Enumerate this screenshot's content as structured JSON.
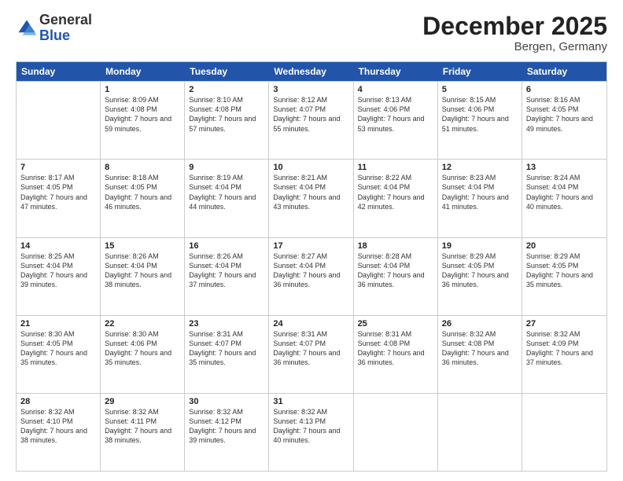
{
  "header": {
    "logo_general": "General",
    "logo_blue": "Blue",
    "month_title": "December 2025",
    "location": "Bergen, Germany"
  },
  "days_of_week": [
    "Sunday",
    "Monday",
    "Tuesday",
    "Wednesday",
    "Thursday",
    "Friday",
    "Saturday"
  ],
  "weeks": [
    [
      {
        "day": "",
        "sunrise": "",
        "sunset": "",
        "daylight": ""
      },
      {
        "day": "1",
        "sunrise": "Sunrise: 8:09 AM",
        "sunset": "Sunset: 4:08 PM",
        "daylight": "Daylight: 7 hours and 59 minutes."
      },
      {
        "day": "2",
        "sunrise": "Sunrise: 8:10 AM",
        "sunset": "Sunset: 4:08 PM",
        "daylight": "Daylight: 7 hours and 57 minutes."
      },
      {
        "day": "3",
        "sunrise": "Sunrise: 8:12 AM",
        "sunset": "Sunset: 4:07 PM",
        "daylight": "Daylight: 7 hours and 55 minutes."
      },
      {
        "day": "4",
        "sunrise": "Sunrise: 8:13 AM",
        "sunset": "Sunset: 4:06 PM",
        "daylight": "Daylight: 7 hours and 53 minutes."
      },
      {
        "day": "5",
        "sunrise": "Sunrise: 8:15 AM",
        "sunset": "Sunset: 4:06 PM",
        "daylight": "Daylight: 7 hours and 51 minutes."
      },
      {
        "day": "6",
        "sunrise": "Sunrise: 8:16 AM",
        "sunset": "Sunset: 4:05 PM",
        "daylight": "Daylight: 7 hours and 49 minutes."
      }
    ],
    [
      {
        "day": "7",
        "sunrise": "Sunrise: 8:17 AM",
        "sunset": "Sunset: 4:05 PM",
        "daylight": "Daylight: 7 hours and 47 minutes."
      },
      {
        "day": "8",
        "sunrise": "Sunrise: 8:18 AM",
        "sunset": "Sunset: 4:05 PM",
        "daylight": "Daylight: 7 hours and 46 minutes."
      },
      {
        "day": "9",
        "sunrise": "Sunrise: 8:19 AM",
        "sunset": "Sunset: 4:04 PM",
        "daylight": "Daylight: 7 hours and 44 minutes."
      },
      {
        "day": "10",
        "sunrise": "Sunrise: 8:21 AM",
        "sunset": "Sunset: 4:04 PM",
        "daylight": "Daylight: 7 hours and 43 minutes."
      },
      {
        "day": "11",
        "sunrise": "Sunrise: 8:22 AM",
        "sunset": "Sunset: 4:04 PM",
        "daylight": "Daylight: 7 hours and 42 minutes."
      },
      {
        "day": "12",
        "sunrise": "Sunrise: 8:23 AM",
        "sunset": "Sunset: 4:04 PM",
        "daylight": "Daylight: 7 hours and 41 minutes."
      },
      {
        "day": "13",
        "sunrise": "Sunrise: 8:24 AM",
        "sunset": "Sunset: 4:04 PM",
        "daylight": "Daylight: 7 hours and 40 minutes."
      }
    ],
    [
      {
        "day": "14",
        "sunrise": "Sunrise: 8:25 AM",
        "sunset": "Sunset: 4:04 PM",
        "daylight": "Daylight: 7 hours and 39 minutes."
      },
      {
        "day": "15",
        "sunrise": "Sunrise: 8:26 AM",
        "sunset": "Sunset: 4:04 PM",
        "daylight": "Daylight: 7 hours and 38 minutes."
      },
      {
        "day": "16",
        "sunrise": "Sunrise: 8:26 AM",
        "sunset": "Sunset: 4:04 PM",
        "daylight": "Daylight: 7 hours and 37 minutes."
      },
      {
        "day": "17",
        "sunrise": "Sunrise: 8:27 AM",
        "sunset": "Sunset: 4:04 PM",
        "daylight": "Daylight: 7 hours and 36 minutes."
      },
      {
        "day": "18",
        "sunrise": "Sunrise: 8:28 AM",
        "sunset": "Sunset: 4:04 PM",
        "daylight": "Daylight: 7 hours and 36 minutes."
      },
      {
        "day": "19",
        "sunrise": "Sunrise: 8:29 AM",
        "sunset": "Sunset: 4:05 PM",
        "daylight": "Daylight: 7 hours and 36 minutes."
      },
      {
        "day": "20",
        "sunrise": "Sunrise: 8:29 AM",
        "sunset": "Sunset: 4:05 PM",
        "daylight": "Daylight: 7 hours and 35 minutes."
      }
    ],
    [
      {
        "day": "21",
        "sunrise": "Sunrise: 8:30 AM",
        "sunset": "Sunset: 4:05 PM",
        "daylight": "Daylight: 7 hours and 35 minutes."
      },
      {
        "day": "22",
        "sunrise": "Sunrise: 8:30 AM",
        "sunset": "Sunset: 4:06 PM",
        "daylight": "Daylight: 7 hours and 35 minutes."
      },
      {
        "day": "23",
        "sunrise": "Sunrise: 8:31 AM",
        "sunset": "Sunset: 4:07 PM",
        "daylight": "Daylight: 7 hours and 35 minutes."
      },
      {
        "day": "24",
        "sunrise": "Sunrise: 8:31 AM",
        "sunset": "Sunset: 4:07 PM",
        "daylight": "Daylight: 7 hours and 36 minutes."
      },
      {
        "day": "25",
        "sunrise": "Sunrise: 8:31 AM",
        "sunset": "Sunset: 4:08 PM",
        "daylight": "Daylight: 7 hours and 36 minutes."
      },
      {
        "day": "26",
        "sunrise": "Sunrise: 8:32 AM",
        "sunset": "Sunset: 4:08 PM",
        "daylight": "Daylight: 7 hours and 36 minutes."
      },
      {
        "day": "27",
        "sunrise": "Sunrise: 8:32 AM",
        "sunset": "Sunset: 4:09 PM",
        "daylight": "Daylight: 7 hours and 37 minutes."
      }
    ],
    [
      {
        "day": "28",
        "sunrise": "Sunrise: 8:32 AM",
        "sunset": "Sunset: 4:10 PM",
        "daylight": "Daylight: 7 hours and 38 minutes."
      },
      {
        "day": "29",
        "sunrise": "Sunrise: 8:32 AM",
        "sunset": "Sunset: 4:11 PM",
        "daylight": "Daylight: 7 hours and 38 minutes."
      },
      {
        "day": "30",
        "sunrise": "Sunrise: 8:32 AM",
        "sunset": "Sunset: 4:12 PM",
        "daylight": "Daylight: 7 hours and 39 minutes."
      },
      {
        "day": "31",
        "sunrise": "Sunrise: 8:32 AM",
        "sunset": "Sunset: 4:13 PM",
        "daylight": "Daylight: 7 hours and 40 minutes."
      },
      {
        "day": "",
        "sunrise": "",
        "sunset": "",
        "daylight": ""
      },
      {
        "day": "",
        "sunrise": "",
        "sunset": "",
        "daylight": ""
      },
      {
        "day": "",
        "sunrise": "",
        "sunset": "",
        "daylight": ""
      }
    ]
  ]
}
